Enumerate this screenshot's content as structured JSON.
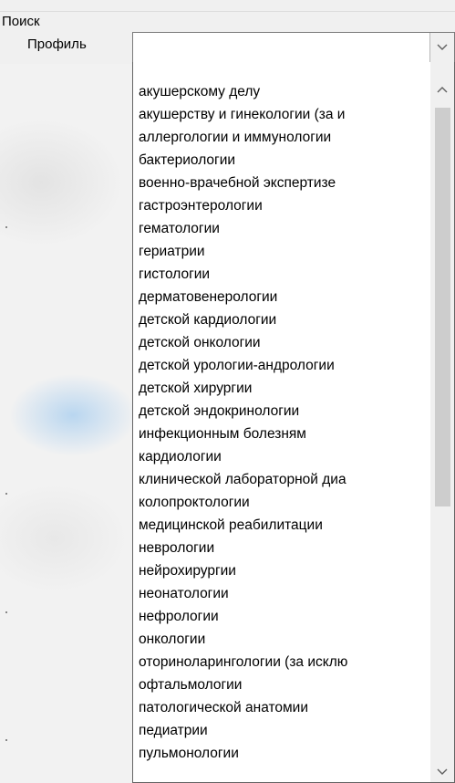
{
  "search_group": {
    "title": "Поиск",
    "profile_label": "Профиль",
    "profile_value": ""
  },
  "dropdown": {
    "items": [
      "акушерскому делу",
      "акушерству и гинекологии (за и",
      "аллергологии и иммунологии",
      "бактериологии",
      "военно-врачебной экспертизе",
      "гастроэнтерологии",
      "гематологии",
      "гериатрии",
      "гистологии",
      "дерматовенерологии",
      "детской кардиологии",
      "детской онкологии",
      "детской урологии-андрологии",
      "детской хирургии",
      "детской эндокринологии",
      "инфекционным болезням",
      "кардиологии",
      "клинической лабораторной диа",
      "колопроктологии",
      "медицинской реабилитации",
      "неврологии",
      "нейрохирургии",
      "неонатологии",
      "нефрологии",
      "онкологии",
      "оториноларингологии (за исклю",
      "офтальмологии",
      "патологической анатомии",
      "педиатрии",
      "пульмонологии"
    ],
    "scroll_position_fraction": 0.0
  },
  "icons": {
    "combo_arrow": "chevron-down-icon",
    "scroll_up": "scroll-up-arrow-icon",
    "scroll_down": "scroll-down-arrow-icon"
  },
  "colors": {
    "window_bg": "#f0f0f0",
    "list_bg": "#ffffff",
    "border": "#7a7a7a",
    "scroll_thumb": "#cdcdcd",
    "arrow": "#606060"
  }
}
